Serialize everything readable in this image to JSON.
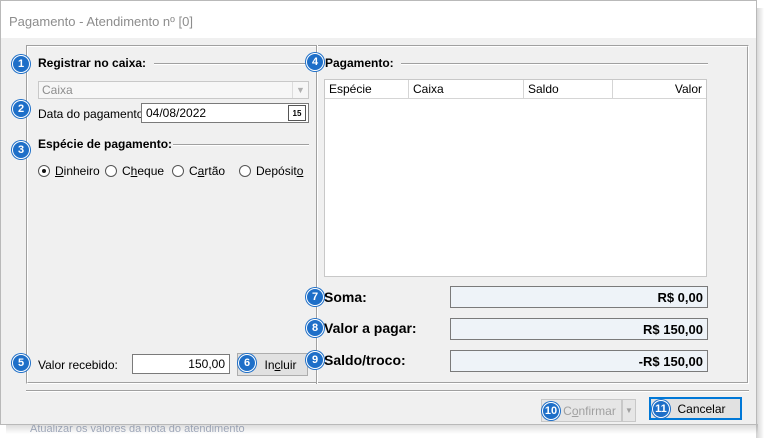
{
  "window": {
    "title": "Pagamento - Atendimento nº [0]"
  },
  "badges": [
    "1",
    "2",
    "3",
    "4",
    "5",
    "6",
    "7",
    "8",
    "9",
    "10",
    "11"
  ],
  "registrar": {
    "title": "Registrar no caixa:",
    "caixa_value": "Caixa",
    "date_label": "Data do pagamento",
    "date_value": "04/08/2022",
    "calendar_glyph": "15"
  },
  "especie": {
    "title": "Espécie de pagamento:",
    "options": [
      {
        "label": "Dinheiro",
        "accel": "D",
        "rest": "inheiro",
        "selected": true
      },
      {
        "label": "Cheque",
        "pre": "C",
        "accel": "h",
        "rest": "eque",
        "selected": false
      },
      {
        "label": "Cartão",
        "pre": "C",
        "accel": "a",
        "rest": "rtão",
        "selected": false
      },
      {
        "label": "Depósito",
        "pre": "Depósit",
        "accel": "o",
        "rest": "",
        "selected": false
      }
    ]
  },
  "valor": {
    "label": "Valor recebido:",
    "value": "150,00",
    "incluir_pre": "In",
    "incluir_accel": "c",
    "incluir_rest": "luir"
  },
  "pagamento": {
    "title": "Pagamento:",
    "columns": [
      "Espécie",
      "Caixa",
      "Saldo",
      "Valor"
    ]
  },
  "totals": {
    "soma_label": "Soma:",
    "soma_value": "R$ 0,00",
    "apagar_label": "Valor a pagar:",
    "apagar_value": "R$ 150,00",
    "saldo_label": "Saldo/troco:",
    "saldo_value": "-R$ 150,00"
  },
  "footer": {
    "confirmar_pre": "C",
    "confirmar_accel": "o",
    "confirmar_rest": "nfirmar",
    "cancelar": "Cancelar",
    "background_text": "Atualizar os valores da nota do atendimento"
  }
}
